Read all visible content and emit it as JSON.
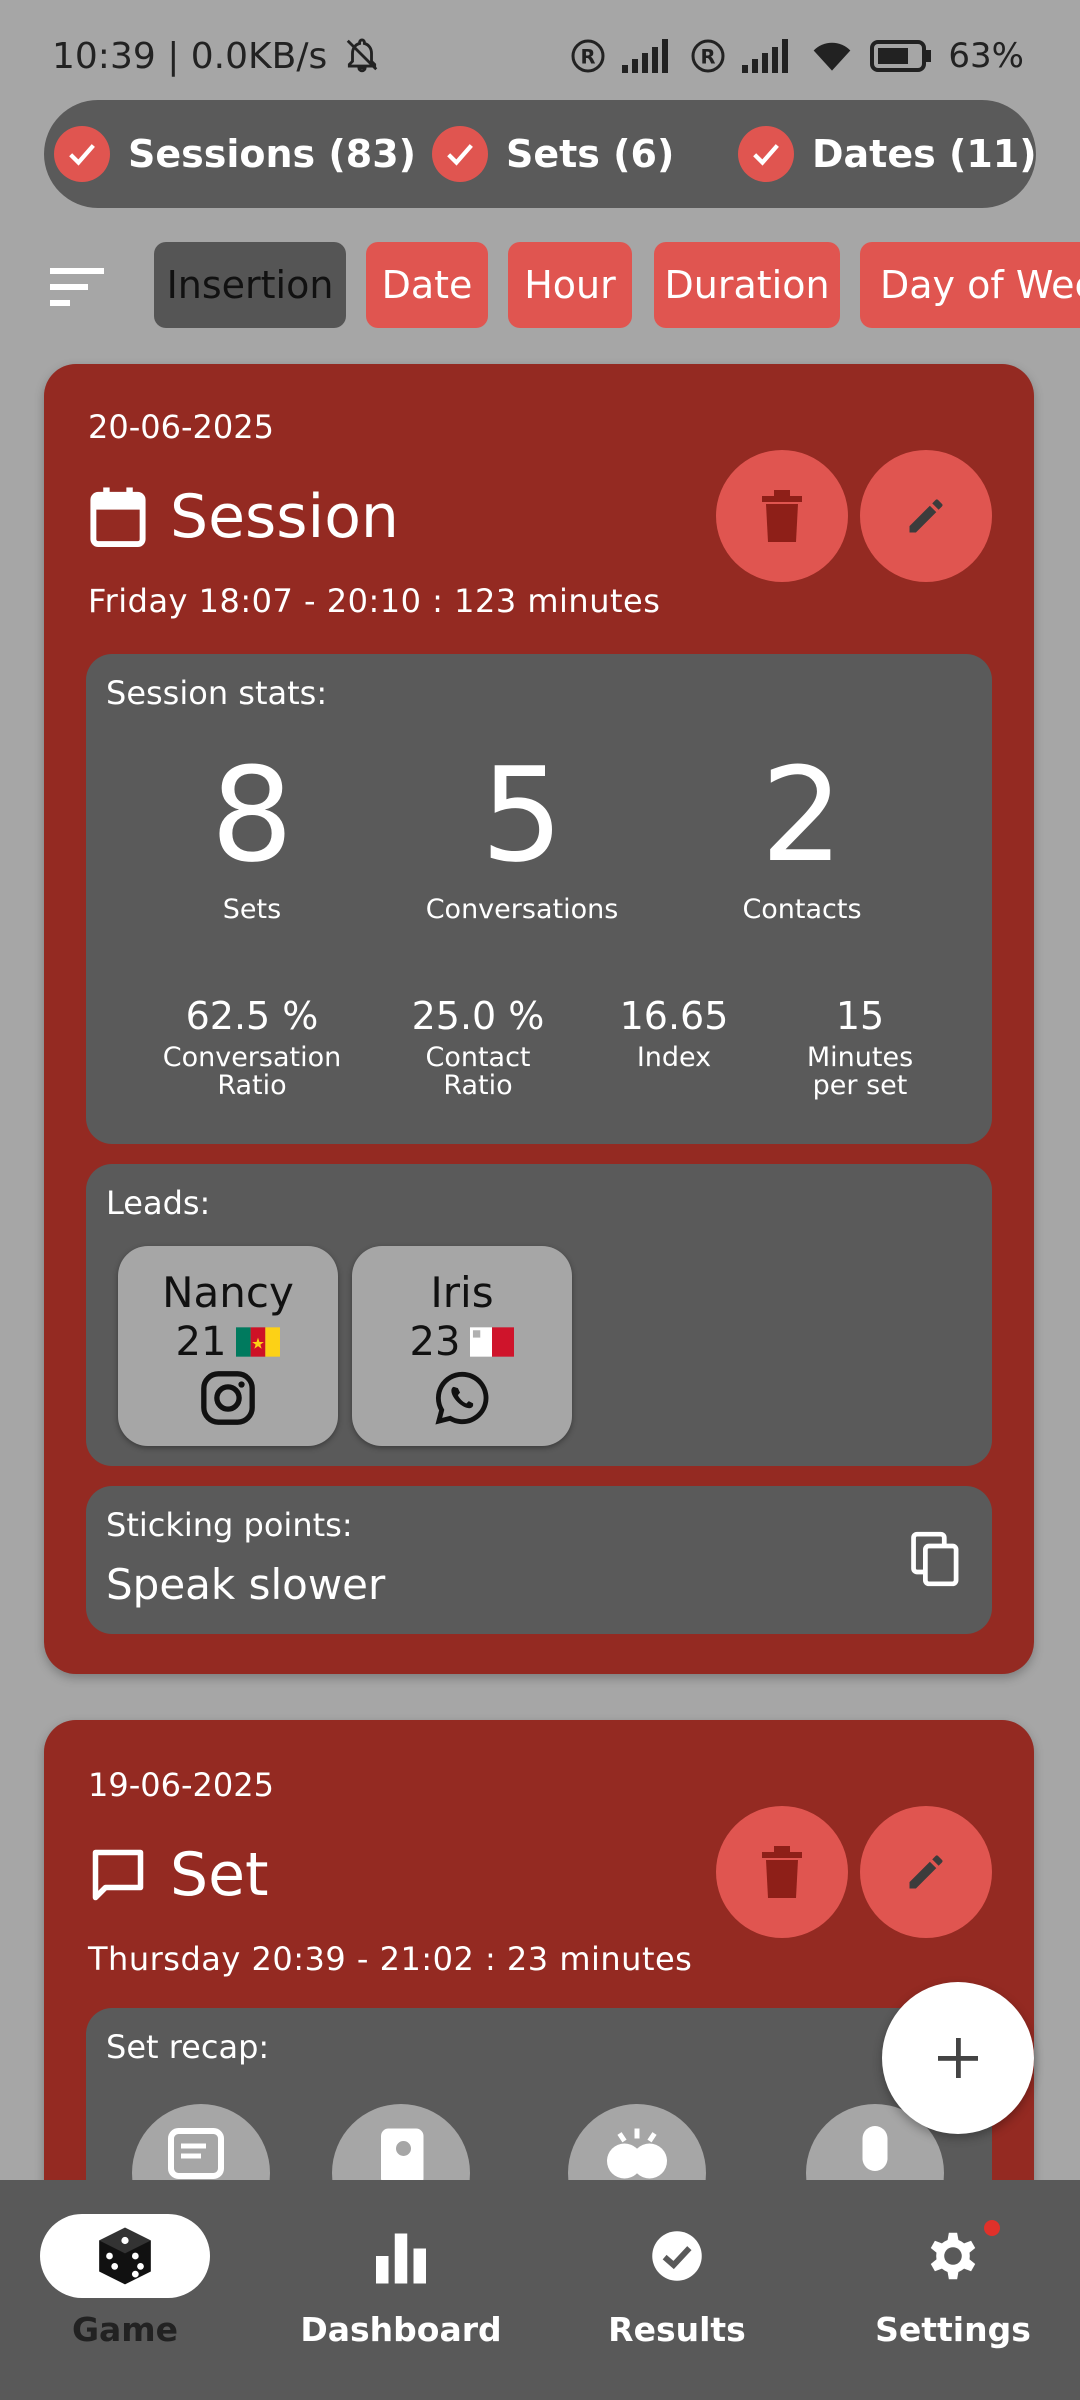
{
  "status_bar": {
    "time_network": "10:39 | 0.0KB/s",
    "battery": "63%"
  },
  "filters": [
    {
      "label": "Sessions (83)",
      "checked": true
    },
    {
      "label": "Sets (6)",
      "checked": true
    },
    {
      "label": "Dates (11)",
      "checked": true
    }
  ],
  "sort_chips": [
    {
      "label": "Insertion",
      "active": true
    },
    {
      "label": "Date",
      "active": false
    },
    {
      "label": "Hour",
      "active": false
    },
    {
      "label": "Duration",
      "active": false
    },
    {
      "label": "Day of Week",
      "active": false
    }
  ],
  "session_card": {
    "date": "20-06-2025",
    "title": "Session",
    "subtitle": "Friday 18:07 - 20:10 : 123 minutes",
    "stats_label": "Session stats:",
    "big_stats": [
      {
        "value": "8",
        "label": "Sets"
      },
      {
        "value": "5",
        "label": "Conversations"
      },
      {
        "value": "2",
        "label": "Contacts"
      }
    ],
    "small_stats": [
      {
        "value": "62.5 %",
        "label1": "Conversation",
        "label2": "Ratio"
      },
      {
        "value": "25.0 %",
        "label1": "Contact",
        "label2": "Ratio"
      },
      {
        "value": "16.65",
        "label1": "Index",
        "label2": ""
      },
      {
        "value": "15",
        "label1": "Minutes",
        "label2": "per set"
      }
    ],
    "leads_label": "Leads:",
    "leads": [
      {
        "name": "Nancy",
        "age": "21",
        "flag": "Cameroon",
        "contact": "instagram"
      },
      {
        "name": "Iris",
        "age": "23",
        "flag": "Malta",
        "contact": "whatsapp"
      }
    ],
    "sticking_label": "Sticking points:",
    "sticking_value": "Speak slower"
  },
  "set_card": {
    "date": "19-06-2025",
    "title": "Set",
    "subtitle": "Thursday 20:39 - 21:02 : 23 minutes",
    "recap_label": "Set recap:"
  },
  "nav": [
    {
      "label": "Game",
      "icon": "dice-icon",
      "active": true
    },
    {
      "label": "Dashboard",
      "icon": "bar-chart-icon",
      "active": false
    },
    {
      "label": "Results",
      "icon": "check-circle-icon",
      "active": false
    },
    {
      "label": "Settings",
      "icon": "gear-icon",
      "active": false,
      "badge": true
    }
  ],
  "colors": {
    "background": "#a6a6a6",
    "card": "#942a22",
    "accent": "#e05550",
    "panel": "#5a5a5a",
    "nav": "#595959"
  }
}
